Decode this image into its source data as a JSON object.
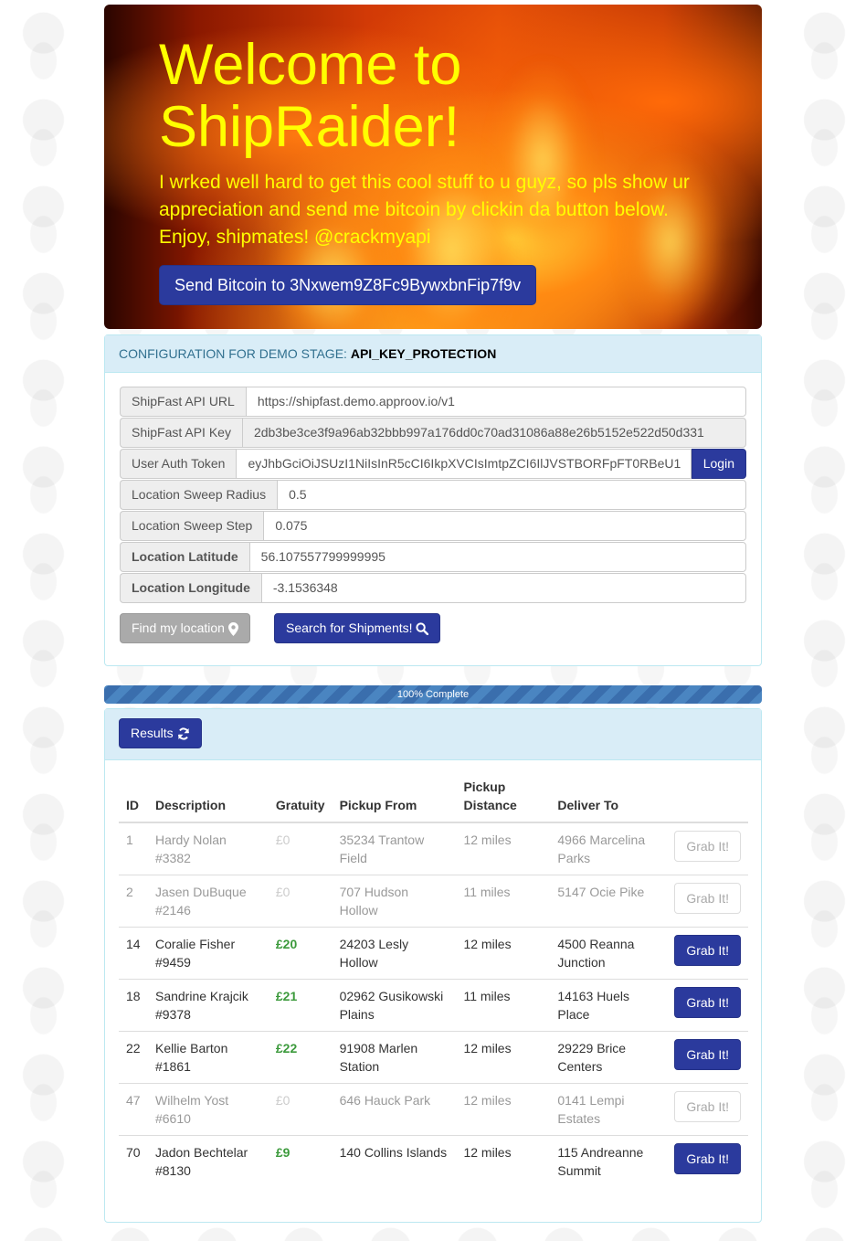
{
  "hero": {
    "title": "Welcome to ShipRaider!",
    "message": "I wrked well hard to get this cool stuff to u guyz, so pls show ur appreciation and send me bitcoin by clickin da button below. Enjoy, shipmates! @crackmyapi",
    "bitcoin_button": "Send Bitcoin to 3Nxwem9Z8Fc9BywxbnFip7f9v"
  },
  "config": {
    "heading_prefix": "CONFIGURATION FOR DEMO STAGE:",
    "heading_stage": "API_KEY_PROTECTION",
    "fields": {
      "api_url": {
        "label": "ShipFast API URL",
        "value": "https://shipfast.demo.approov.io/v1"
      },
      "api_key": {
        "label": "ShipFast API Key",
        "value": "2db3be3ce3f9a96ab32bbb997a176dd0c70ad31086a88e26b5152e522d50d331"
      },
      "auth_token": {
        "label": "User Auth Token",
        "value": "eyJhbGciOiJSUzI1NiIsInR5cCI6IkpXVCIsImtpZCI6IlJVSTBORFpFT0RBeU1"
      },
      "sweep_radius": {
        "label": "Location Sweep Radius",
        "value": "0.5"
      },
      "sweep_step": {
        "label": "Location Sweep Step",
        "value": "0.075"
      },
      "latitude": {
        "label": "Location Latitude",
        "value": "56.107557799999995"
      },
      "longitude": {
        "label": "Location Longitude",
        "value": "-3.1536348"
      }
    },
    "login_button": "Login",
    "find_location_button": "Find my location",
    "search_button": "Search for Shipments!"
  },
  "progress": {
    "label": "100% Complete",
    "percent": 100
  },
  "results": {
    "button": "Results",
    "columns": [
      "ID",
      "Description",
      "Gratuity",
      "Pickup From",
      "Pickup Distance",
      "Deliver To",
      ""
    ],
    "grab_label": "Grab It!",
    "rows": [
      {
        "id": "1",
        "description": "Hardy Nolan #3382",
        "gratuity": "£0",
        "pickup": "35234 Trantow Field",
        "distance": "12 miles",
        "deliver": "4966 Marcelina Parks",
        "active": false
      },
      {
        "id": "2",
        "description": "Jasen DuBuque #2146",
        "gratuity": "£0",
        "pickup": "707 Hudson Hollow",
        "distance": "11 miles",
        "deliver": "5147 Ocie Pike",
        "active": false
      },
      {
        "id": "14",
        "description": "Coralie Fisher #9459",
        "gratuity": "£20",
        "pickup": "24203 Lesly Hollow",
        "distance": "12 miles",
        "deliver": "4500 Reanna Junction",
        "active": true
      },
      {
        "id": "18",
        "description": "Sandrine Krajcik #9378",
        "gratuity": "£21",
        "pickup": "02962 Gusikowski Plains",
        "distance": "11 miles",
        "deliver": "14163 Huels Place",
        "active": true
      },
      {
        "id": "22",
        "description": "Kellie Barton #1861",
        "gratuity": "£22",
        "pickup": "91908 Marlen Station",
        "distance": "12 miles",
        "deliver": "29229 Brice Centers",
        "active": true
      },
      {
        "id": "47",
        "description": "Wilhelm Yost #6610",
        "gratuity": "£0",
        "pickup": "646 Hauck Park",
        "distance": "12 miles",
        "deliver": "0141 Lempi Estates",
        "active": false
      },
      {
        "id": "70",
        "description": "Jadon Bechtelar #8130",
        "gratuity": "£9",
        "pickup": "140 Collins Islands",
        "distance": "12 miles",
        "deliver": "115 Andreanne Summit",
        "active": true
      }
    ]
  },
  "colors": {
    "primary": "#2b3a9d",
    "hero_text": "#ffff00",
    "panel_heading": "#d9edf7",
    "gratuity": "#3c9a3c"
  }
}
